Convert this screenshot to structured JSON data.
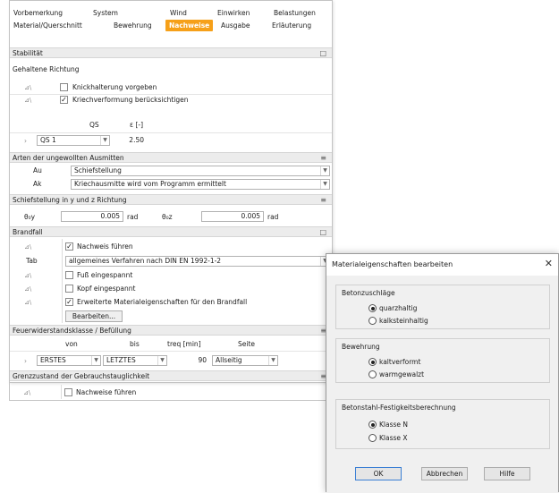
{
  "tabs_row1": [
    "Vorbemerkung",
    "System",
    "Wind",
    "Einwirken",
    "Belastungen"
  ],
  "tabs_row2": [
    "Material/Querschnitt",
    "Bewehrung",
    "Nachweise",
    "Ausgabe",
    "Erläuterung"
  ],
  "active_tab": "Nachweise",
  "stabilitaet": {
    "header": "Stabilität",
    "subtitle": "Gehaltene Richtung",
    "rows": [
      {
        "icon": "⊿\\",
        "label": "Knickhalterung vorgeben",
        "checked": false
      },
      {
        "icon": "⊿\\",
        "label": "Kriechverformung berücksichtigen",
        "checked": true
      }
    ],
    "table_headers": [
      "QS",
      "ε [-]"
    ],
    "qs_value": "QS 1",
    "eps_value": "2.50"
  },
  "imperfektion": {
    "header": "Arten der ungewollten Ausmitten",
    "rows": [
      {
        "label": "Au",
        "value": "Schiefstellung"
      },
      {
        "label": "Ak",
        "value": "Kriechausmitte wird vom Programm ermittelt"
      }
    ]
  },
  "schiefstellung": {
    "header": "Schiefstellung in y und z Richtung",
    "label_y": "θ₀y",
    "value_y": "0.005",
    "unit_y": "rad",
    "label_z": "θ₀z",
    "value_z": "0.005",
    "unit_z": "rad"
  },
  "brandfall": {
    "header": "Brandfall",
    "rows": [
      {
        "icon": "⊿\\",
        "label": "Nachweis führen",
        "checked": true
      },
      {
        "icon": "",
        "label": "Tab",
        "value": "allgemeines Verfahren nach DIN EN 1992-1-2"
      },
      {
        "icon": "⊿\\",
        "label": "Fuß eingespannt",
        "checked": false
      },
      {
        "icon": "⊿\\",
        "label": "Kopf eingespannt",
        "checked": false
      },
      {
        "icon": "⊿\\",
        "label": "Erweiterte Materialeigenschaften für den Brandfall",
        "checked": true
      }
    ],
    "button": "Bearbeiten..."
  },
  "feuerwiderstand": {
    "header": "Feuerwiderstandsklasse / Befüllung",
    "headers": [
      "von",
      "bis",
      "treq [min]",
      "Seite"
    ],
    "von": "ERSTES",
    "bis": "LETZTES",
    "treq": "90",
    "seite": "Allseitig"
  },
  "gebrauch": {
    "header": "Grenzzustand der Gebrauchstauglichkeit",
    "icon": "⊿\\",
    "label": "Nachweise führen",
    "checked": false
  },
  "dialog": {
    "title": "Materialeigenschaften bearbeiten",
    "close": "✕",
    "groups": [
      {
        "title": "Betonzuschläge",
        "options": [
          {
            "label": "quarzhaltig",
            "selected": true
          },
          {
            "label": "kalksteinhaltig",
            "selected": false
          }
        ]
      },
      {
        "title": "Bewehrung",
        "options": [
          {
            "label": "kaltverformt",
            "selected": true
          },
          {
            "label": "warmgewalzt",
            "selected": false
          }
        ]
      },
      {
        "title": "Betonstahl-Festigkeitsberechnung",
        "options": [
          {
            "label": "Klasse N",
            "selected": true
          },
          {
            "label": "Klasse X",
            "selected": false
          }
        ]
      }
    ],
    "buttons": [
      "OK",
      "Abbrechen",
      "Hilfe"
    ]
  },
  "colors": {
    "accent": "#f6a019",
    "section_bg": "#ececec",
    "dialog_bg": "#f0f0f0"
  }
}
